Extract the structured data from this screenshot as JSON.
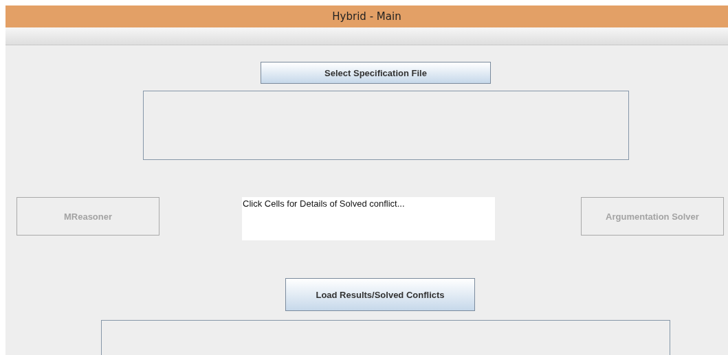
{
  "window": {
    "title": "Hybrid - Main"
  },
  "select_specification_button": {
    "label": "Select Specification File",
    "disabled": false
  },
  "mreasoner_button": {
    "label": "MReasoner",
    "disabled": true
  },
  "details_area": {
    "value": "Click Cells for Details of Solved conflict..."
  },
  "argumentation_solver_button": {
    "label": "Argumentation Solver",
    "disabled": true
  },
  "load_results_button": {
    "label": "Load Results/Solved Conflicts",
    "disabled": false
  }
}
